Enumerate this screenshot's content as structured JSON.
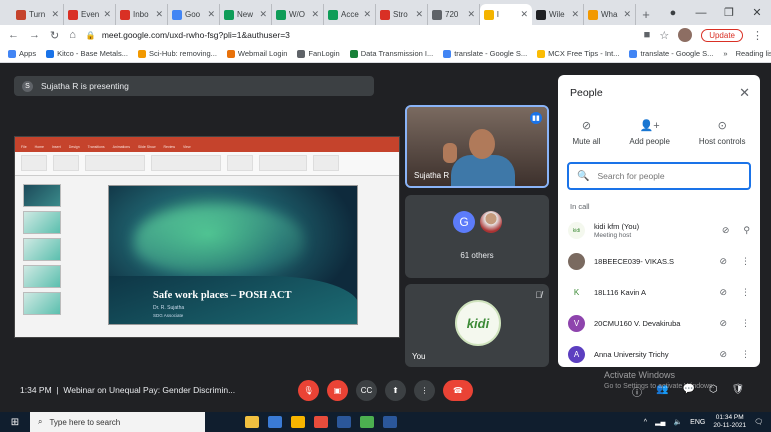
{
  "browser": {
    "tabs": [
      {
        "label": "Turn",
        "color": "#c5432c"
      },
      {
        "label": "Even",
        "color": "#d93025"
      },
      {
        "label": "Inbo",
        "color": "#d93025"
      },
      {
        "label": "Goo",
        "color": "#4285f4"
      },
      {
        "label": "New",
        "color": "#0f9d58"
      },
      {
        "label": "W/O",
        "color": "#0f9d58"
      },
      {
        "label": "Acce",
        "color": "#0f9d58"
      },
      {
        "label": "Stro",
        "color": "#d93025"
      },
      {
        "label": "720",
        "color": "#5f6368"
      },
      {
        "label": "l",
        "color": "#f4b400",
        "active": true
      },
      {
        "label": "Wile",
        "color": "#202124"
      },
      {
        "label": "Wha",
        "color": "#f29900"
      }
    ],
    "url": "meet.google.com/uxd-rwho-fsg?pli=1&authuser=3",
    "update_label": "Update",
    "bookmarks": [
      "Apps",
      "Kitco - Base Metals...",
      "Sci-Hub: removing...",
      "Webmail Login",
      "FanLogin",
      "Data Transmission I...",
      "translate - Google S...",
      "MCX Free Tips - Int...",
      "translate - Google S..."
    ],
    "reading_list": "Reading list"
  },
  "presenting": {
    "initial": "S",
    "text": "Sujatha R is presenting"
  },
  "slide": {
    "title": "Safe work places – POSH ACT",
    "author": "Dr. R. Sujatha",
    "role": "SDG Associate"
  },
  "tiles": {
    "speaker_name": "Sujatha R",
    "others_initial": "G",
    "others_count": "61 others",
    "you_label": "You",
    "you_logo": "kidi"
  },
  "people": {
    "title": "People",
    "actions": [
      {
        "label": "Mute all",
        "icon": "mic-off-icon"
      },
      {
        "label": "Add people",
        "icon": "person-add-icon"
      },
      {
        "label": "Host controls",
        "icon": "toggle-icon"
      }
    ],
    "search_placeholder": "Search for people",
    "in_call_label": "In call",
    "participants": [
      {
        "name": "kidi kfm (You)",
        "role": "Meeting host",
        "avatar": "kidi",
        "color": "#f4f8ee"
      },
      {
        "name": "18BEECE039- VIKAS.S",
        "role": "",
        "avatar": "",
        "color": "#7a6a60"
      },
      {
        "name": "18L116 Kavin A",
        "role": "",
        "avatar": "K",
        "color": "#ffffff"
      },
      {
        "name": "20CMU160 V. Devakiruba",
        "role": "",
        "avatar": "V",
        "color": "#8e44ad"
      },
      {
        "name": "Anna University Trichy",
        "role": "",
        "avatar": "A",
        "color": "#5c3fc0"
      }
    ]
  },
  "meeting": {
    "time": "1:34 PM",
    "separator": "|",
    "name": "Webinar on Unequal Pay: Gender Discrimin..."
  },
  "watermark": {
    "line1": "Activate Windows",
    "line2": "Go to Settings to activate Windows."
  },
  "taskbar": {
    "search_placeholder": "Type here to search",
    "lang": "ENG",
    "time": "01:34 PM",
    "date": "20-11-2021"
  }
}
